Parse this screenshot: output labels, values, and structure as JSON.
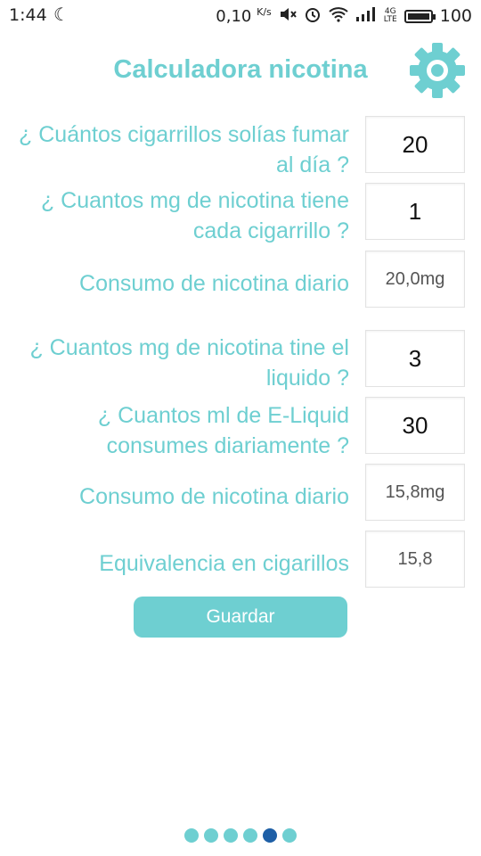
{
  "status_bar": {
    "time": "1:44",
    "network_speed": "0,10",
    "network_speed_unit": "K/s",
    "network_type": "4G",
    "network_subtype": "LTE",
    "battery": "100"
  },
  "header": {
    "title": "Calculadora nicotina"
  },
  "form": {
    "cigarettes_label": "¿ Cuántos cigarrillos solías fumar al día ?",
    "cigarettes_value": "20",
    "mg_per_cigarette_label": "¿ Cuantos mg de nicotina tiene cada cigarrillo ?",
    "mg_per_cigarette_value": "1",
    "daily_consumption_label_1": "Consumo de nicotina diario",
    "daily_consumption_value_1": "20,0mg",
    "liquid_mg_label": "¿ Cuantos mg de nicotina tine el liquido ?",
    "liquid_mg_value": "3",
    "liquid_ml_label": "¿ Cuantos ml de E-Liquid consumes diariamente ?",
    "liquid_ml_value": "30",
    "daily_consumption_label_2": "Consumo de nicotina diario",
    "daily_consumption_value_2": "15,8mg",
    "equivalence_label": "Equivalencia en cigarillos",
    "equivalence_value": "15,8"
  },
  "actions": {
    "save_label": "Guardar"
  },
  "pager": {
    "total": 6,
    "active_index": 4
  },
  "colors": {
    "accent": "#6ecfd1",
    "active_dot": "#1e5fa6"
  }
}
